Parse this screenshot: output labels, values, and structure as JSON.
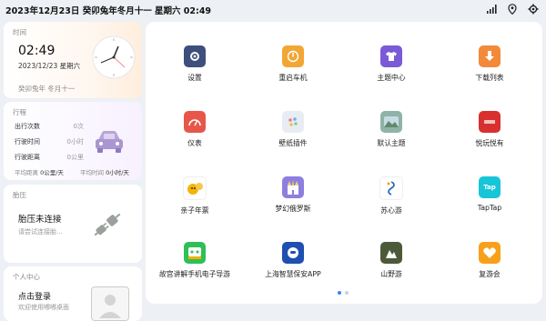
{
  "status_bar": {
    "datetime": "2023年12月23日  癸卯兔年冬月十一  星期六  02:49",
    "icons": [
      "signal-icon",
      "location-pin-icon",
      "settings-gear-icon"
    ]
  },
  "time_card": {
    "title": "时间",
    "time": "02:49",
    "date": "2023/12/23 星期六",
    "lunar": "癸卯兔年 冬月十一"
  },
  "trip_card": {
    "title": "行程",
    "rows": [
      {
        "label": "出行次数",
        "value": "0次"
      },
      {
        "label": "行驶时间",
        "value": "0小时"
      },
      {
        "label": "行驶距离",
        "value": "0公里"
      }
    ],
    "avg_distance_label": "平均距离",
    "avg_distance_value": "0公里/天",
    "avg_time_label": "平均时间",
    "avg_time_value": "0小时/天"
  },
  "tire_card": {
    "title": "胎压",
    "status": "胎压未连接",
    "hint": "请尝试连接胎..."
  },
  "user_card": {
    "title": "个人中心",
    "login": "点击登录",
    "hint": "欢迎使用嘟嘟桌面"
  },
  "apps": [
    {
      "label": "设置",
      "color": "#3e4f7e",
      "icon": "gear-icon"
    },
    {
      "label": "重启车机",
      "color": "#f2a634",
      "icon": "power-icon"
    },
    {
      "label": "主题中心",
      "color": "#7a5ad6",
      "icon": "tshirt-icon"
    },
    {
      "label": "下载列表",
      "color": "#f28a3a",
      "icon": "download-arrow-icon"
    },
    {
      "label": "仪表",
      "color": "#e8564a",
      "icon": "gauge-icon"
    },
    {
      "label": "壁纸插件",
      "color": "#e8ecf3",
      "icon": "palette-icon"
    },
    {
      "label": "默认主题",
      "color": "#8fb3a7",
      "icon": "landscape-icon"
    },
    {
      "label": "悦玩悦有",
      "color": "#d8302e",
      "icon": "brand-logo-icon"
    },
    {
      "label": "亲子年票",
      "color": "#ffffff",
      "icon": "cartoon-icon"
    },
    {
      "label": "梦幻俄罗斯",
      "color": "#8d7fe0",
      "icon": "castle-icon"
    },
    {
      "label": "苏心游",
      "color": "#ffffff",
      "icon": "swirl-logo-icon"
    },
    {
      "label": "TapTap",
      "color": "#17c5d8",
      "icon": "taptap-icon"
    },
    {
      "label": "故宫讲解手机电子导游",
      "color": "#2fbf58",
      "icon": "guide-icon"
    },
    {
      "label": "上海智慧保安APP",
      "color": "#1f4fb0",
      "icon": "robot-icon"
    },
    {
      "label": "山野游",
      "color": "#4d5a3a",
      "icon": "mountain-icon"
    },
    {
      "label": "复游会",
      "color": "#f7a11a",
      "icon": "heart-icon"
    }
  ],
  "taptap_text": "Tap",
  "colors": {
    "accent": "#3a82f7",
    "background": "#edf0f4"
  }
}
